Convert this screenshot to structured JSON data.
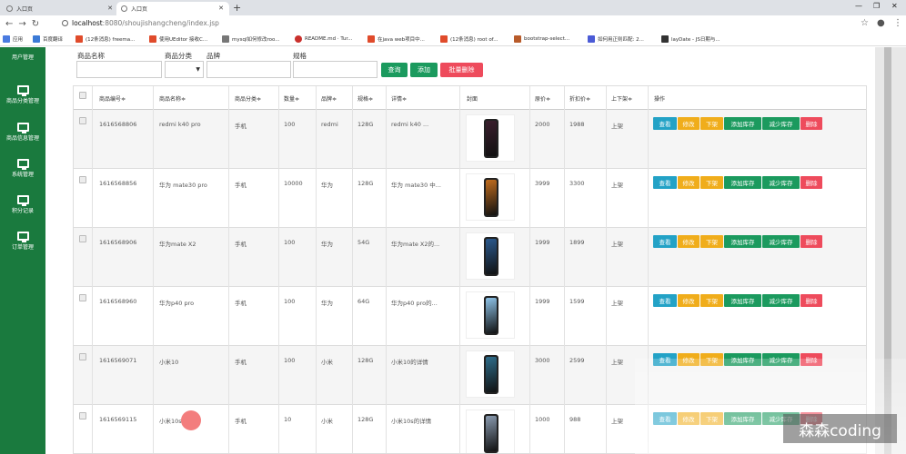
{
  "browser": {
    "tabs": [
      {
        "label": "入口页",
        "active": false
      },
      {
        "label": "入口页",
        "active": true
      }
    ],
    "url_host": "localhost",
    "url_path": ":8080/shoujishangcheng/index.jsp",
    "bookmarks": [
      "应用",
      "百度翻译",
      "(12条消息) freema...",
      "使用UEditor 接收C...",
      "mysql如何修改roo...",
      "README.md · Tur...",
      "在java web项目中...",
      "(12条消息) root of...",
      "bootstrap-select...",
      "如何用正则匹配: 2...",
      "layDate - JS日期与..."
    ]
  },
  "sidebar": {
    "items": [
      "用户管理",
      "商品分类管理",
      "商品信息管理",
      "系统管理",
      "积分记录",
      "订单管理"
    ]
  },
  "filters": {
    "product_name_label": "商品名称",
    "category_label": "商品分类",
    "brand_label": "品牌",
    "spec_label": "规格",
    "query_button": "查询",
    "add_button": "添加",
    "batch_delete_button": "批量删除"
  },
  "table": {
    "headers": [
      "商品编号",
      "商品名称",
      "商品分类",
      "数量",
      "品牌",
      "规格",
      "详情",
      "封面",
      "原价",
      "折扣价",
      "上下架",
      "操作"
    ],
    "rows": [
      {
        "id": "1616568806",
        "name": "redmi k40 pro",
        "category": "手机",
        "qty": "100",
        "brand": "redmi",
        "spec": "128G",
        "detail": "redmi k40 ...",
        "price": "2000",
        "discount": "1988",
        "status": "上架",
        "screen": "#3b1f2e"
      },
      {
        "id": "1616568856",
        "name": "华为 mate30 pro",
        "category": "手机",
        "qty": "10000",
        "brand": "华为",
        "spec": "128G",
        "detail": "华为 mate30 中...",
        "price": "3999",
        "discount": "3300",
        "status": "上架",
        "screen": "#c26d1e"
      },
      {
        "id": "1616568906",
        "name": "华为mate X2",
        "category": "手机",
        "qty": "100",
        "brand": "华为",
        "spec": "54G",
        "detail": "华为mate X2的...",
        "price": "1999",
        "discount": "1899",
        "status": "上架",
        "screen": "#2b5a8f"
      },
      {
        "id": "1616568960",
        "name": "华为p40 pro",
        "category": "手机",
        "qty": "100",
        "brand": "华为",
        "spec": "64G",
        "detail": "华为p40 pro的...",
        "price": "1999",
        "discount": "1599",
        "status": "上架",
        "screen": "#8ec3e8"
      },
      {
        "id": "1616569071",
        "name": "小米10",
        "category": "手机",
        "qty": "100",
        "brand": "小米",
        "spec": "128G",
        "detail": "小米10的详情",
        "price": "3000",
        "discount": "2599",
        "status": "上架",
        "screen": "#2f6e8c"
      },
      {
        "id": "1616569115",
        "name": "小米10s",
        "category": "手机",
        "qty": "10",
        "brand": "小米",
        "spec": "128G",
        "detail": "小米10s的详情",
        "price": "1000",
        "discount": "988",
        "status": "上架",
        "screen": "#8a9bb0"
      }
    ],
    "actions": {
      "view": "查看",
      "edit": "修改",
      "down": "下架",
      "add_stock": "添加库存",
      "reduce_stock": "减少库存",
      "delete": "删除"
    }
  },
  "watermark": "森森coding"
}
